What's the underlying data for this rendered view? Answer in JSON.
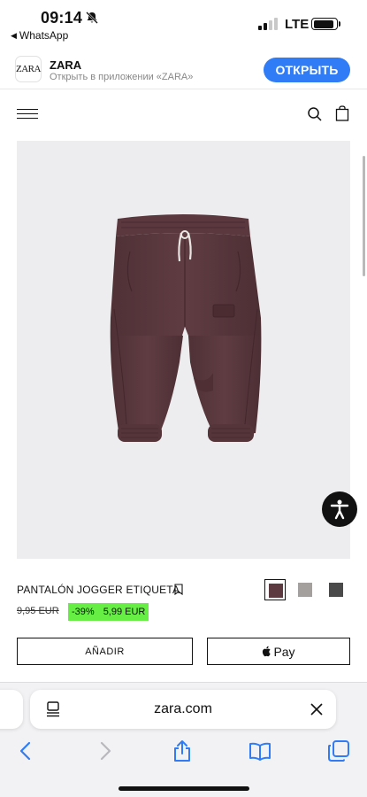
{
  "status_bar": {
    "time": "09:14",
    "back_app": "WhatsApp",
    "network": "LTE",
    "battery_level": 0.9
  },
  "app_banner": {
    "logo_text": "ZARA",
    "title": "ZARA",
    "subtitle": "Открыть в приложении «ZARA»",
    "open_label": "ОТКРЫТЬ"
  },
  "header": {
    "icons": [
      "menu-icon",
      "search-icon",
      "bag-icon"
    ]
  },
  "product": {
    "image_subject": "pants",
    "name": "PANTALÓN JOGGER ETIQUETA",
    "old_price": "9,95 EUR",
    "discount": "-39%",
    "new_price": "5,99 EUR",
    "swatches": [
      {
        "color": "#5c3a3f",
        "selected": true
      },
      {
        "color": "#a3a09e",
        "selected": false
      },
      {
        "color": "#4a4a4a",
        "selected": false
      }
    ],
    "add_label": "AÑADIR",
    "applepay_label": "Pay"
  },
  "browser": {
    "url": "zara.com"
  },
  "colors": {
    "accent_blue": "#2f7cf6",
    "discount_green": "#66ee44",
    "ios_blue": "#2f7cf6"
  }
}
